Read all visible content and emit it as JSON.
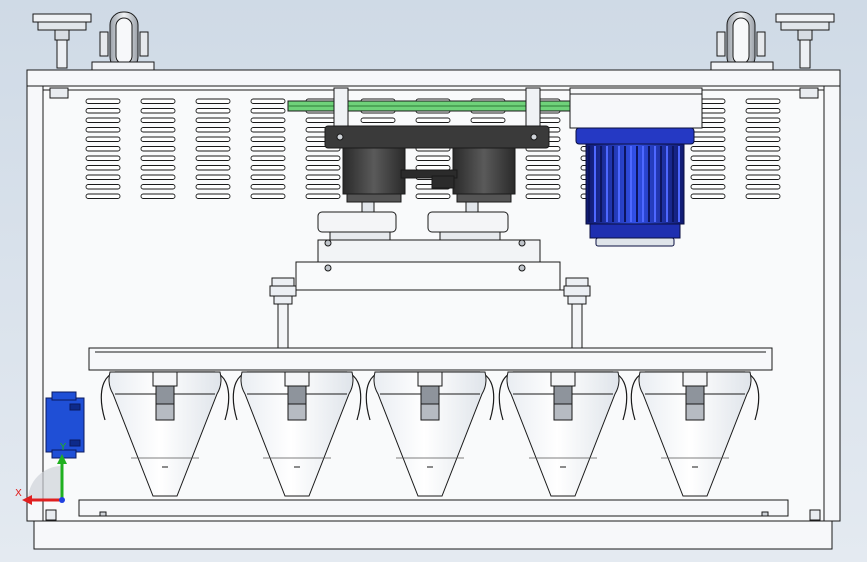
{
  "viewport": {
    "background": "#d6dfe9",
    "part_color": "#f7f8fa",
    "edge_color": "#1a1a1a"
  },
  "triad": {
    "x_label": "X",
    "y_label": "Y",
    "x_color": "#e02020",
    "y_color": "#20b020",
    "z_color": "#2040e0"
  },
  "colors": {
    "belt": "#6fd27a",
    "motor_body": "#1e2fb0",
    "motor_fins": "#3a4fe0",
    "gearbox": "#3b3b3b",
    "bracket": "#1f4fd6"
  },
  "hoppers": [
    "hopper",
    "hopper",
    "hopper",
    "hopper",
    "hopper"
  ]
}
